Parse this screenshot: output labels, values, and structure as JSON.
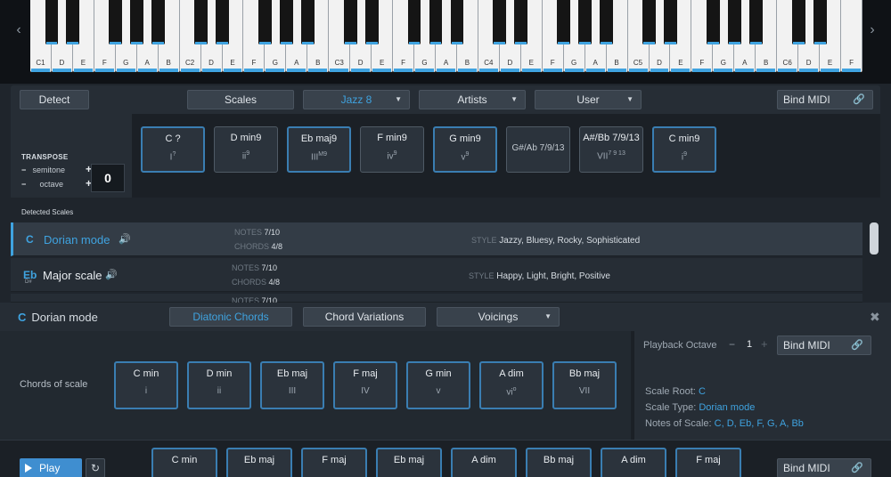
{
  "piano": {
    "left_arrow": "‹",
    "right_arrow": "›",
    "octave_labels": [
      "C1",
      "C2",
      "C3",
      "C4",
      "C5",
      "C6"
    ],
    "white_labels": [
      "C1",
      "D",
      "E",
      "F",
      "G",
      "A",
      "B",
      "C2",
      "D",
      "E",
      "F",
      "G",
      "A",
      "B",
      "C3",
      "D",
      "E",
      "F",
      "G",
      "A",
      "B",
      "C4",
      "D",
      "E",
      "F",
      "G",
      "A",
      "B",
      "C5",
      "D",
      "E",
      "F",
      "G",
      "A",
      "B",
      "C6",
      "D",
      "E",
      "F"
    ],
    "highlight_color": "#3fa3e0"
  },
  "toolbar": {
    "detect": "Detect",
    "scales": "Scales",
    "jazz": "Jazz 8",
    "artists": "Artists",
    "user": "User",
    "bind_midi": "Bind MIDI"
  },
  "transpose": {
    "title": "TRANSPOSE",
    "semitone": "semitone",
    "octave": "octave",
    "value": "0"
  },
  "chords": [
    {
      "name": "C ?",
      "deg": "I",
      "sup": "?",
      "style": "blue"
    },
    {
      "name": "D min9",
      "deg": "ii",
      "sup": "9",
      "style": "plain"
    },
    {
      "name": "Eb maj9",
      "deg": "III",
      "sup": "M9",
      "style": "blue"
    },
    {
      "name": "F min9",
      "deg": "iv",
      "sup": "9",
      "style": "plain"
    },
    {
      "name": "G min9",
      "deg": "v",
      "sup": "9",
      "style": "blue"
    },
    {
      "name": "G#/Ab 7/9/13",
      "deg": "",
      "sup": "",
      "style": "dim"
    },
    {
      "name": "A#/Bb 7/9/13",
      "deg": "VII",
      "sup": "7 9 13",
      "style": "plain"
    },
    {
      "name": "C min9",
      "deg": "i",
      "sup": "9",
      "style": "blue"
    }
  ],
  "detected": {
    "label": "Detected Scales",
    "rows": [
      {
        "root": "C",
        "root_sub": "",
        "name": "Dorian mode",
        "notes_label": "NOTES",
        "notes": "7/10",
        "chords_label": "CHORDS",
        "chords": "4/8",
        "style_label": "STYLE",
        "style": "Jazzy, Bluesy, Rocky, Sophisticated"
      },
      {
        "root": "Eb",
        "root_sub": "D#",
        "name": "Major scale",
        "notes_label": "NOTES",
        "notes": "7/10",
        "chords_label": "CHORDS",
        "chords": "4/8",
        "style_label": "STYLE",
        "style": "Happy, Light, Bright, Positive"
      },
      {
        "root": "",
        "root_sub": "",
        "name": "",
        "notes_label": "NOTES",
        "notes": "7/10",
        "chords_label": "",
        "chords": "",
        "style_label": "",
        "style": ""
      }
    ]
  },
  "bottom": {
    "root": "C",
    "title": "Dorian mode",
    "tab_diatonic": "Diatonic Chords",
    "tab_variations": "Chord Variations",
    "tab_voicings": "Voicings",
    "close": "✖",
    "chords_of_scale_label": "Chords of scale",
    "scale_chords": [
      {
        "name": "C min",
        "deg": "i",
        "sup": ""
      },
      {
        "name": "D min",
        "deg": "ii",
        "sup": ""
      },
      {
        "name": "Eb maj",
        "deg": "III",
        "sup": ""
      },
      {
        "name": "F maj",
        "deg": "IV",
        "sup": ""
      },
      {
        "name": "G min",
        "deg": "v",
        "sup": ""
      },
      {
        "name": "A dim",
        "deg": "vi",
        "sup": "o"
      },
      {
        "name": "Bb maj",
        "deg": "VII",
        "sup": ""
      }
    ],
    "playback_label": "Playback Octave",
    "playback_minus": "−",
    "playback_value": "1",
    "playback_plus": "+",
    "bind_midi": "Bind MIDI",
    "scale_root_label": "Scale Root:",
    "scale_root": "C",
    "scale_type_label": "Scale Type:",
    "scale_type": "Dorian mode",
    "notes_label": "Notes of Scale:",
    "notes": "C, D, Eb, F, G, A, Bb",
    "play": "Play",
    "loop": "↻",
    "seq_chords": [
      "C min",
      "Eb maj",
      "F maj",
      "Eb maj",
      "A dim",
      "Bb maj",
      "A dim",
      "F maj"
    ],
    "bind_midi_2": "Bind MIDI"
  }
}
